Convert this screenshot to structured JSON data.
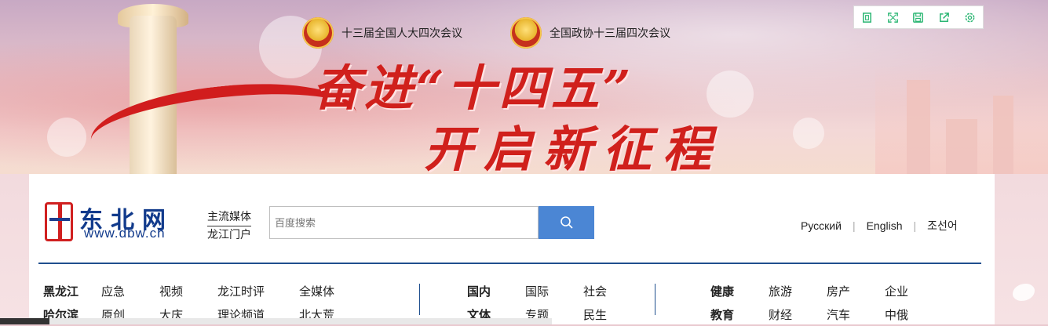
{
  "banner": {
    "event_left": "十三届全国人大四次会议",
    "event_right": "全国政协十三届四次会议",
    "slogan_line1": "奋进“十四五”",
    "slogan_line2": "开启新征程"
  },
  "toolbar": {
    "icons": [
      "bookmark-icon",
      "fullscreen-icon",
      "save-icon",
      "share-icon",
      "settings-icon"
    ],
    "accent": "#2bb673"
  },
  "logo": {
    "name": "东北网",
    "url": "www.dbw.cn"
  },
  "tagline": {
    "line1": "主流媒体",
    "line2": "龙江门户"
  },
  "search": {
    "placeholder": "百度搜索"
  },
  "languages": [
    "Русский",
    "English",
    "조선어"
  ],
  "nav": {
    "group1": {
      "row1": [
        "黑龙江",
        "应急",
        "视频",
        "龙江时评",
        "全媒体"
      ],
      "row2": [
        "哈尔滨",
        "原创",
        "大庆",
        "理论频道",
        "北大荒"
      ]
    },
    "group2": {
      "row1": [
        "国内",
        "国际",
        "社会"
      ],
      "row2": [
        "文体",
        "专题",
        "民生"
      ]
    },
    "group3": {
      "row1": [
        "健康",
        "旅游",
        "房产",
        "企业"
      ],
      "row2": [
        "教育",
        "财经",
        "汽车",
        "中俄"
      ]
    }
  },
  "colors": {
    "brand_blue": "#123b8c",
    "brand_red": "#d02020",
    "search_button": "#4b86d4",
    "divider": "#1f4f8e"
  }
}
